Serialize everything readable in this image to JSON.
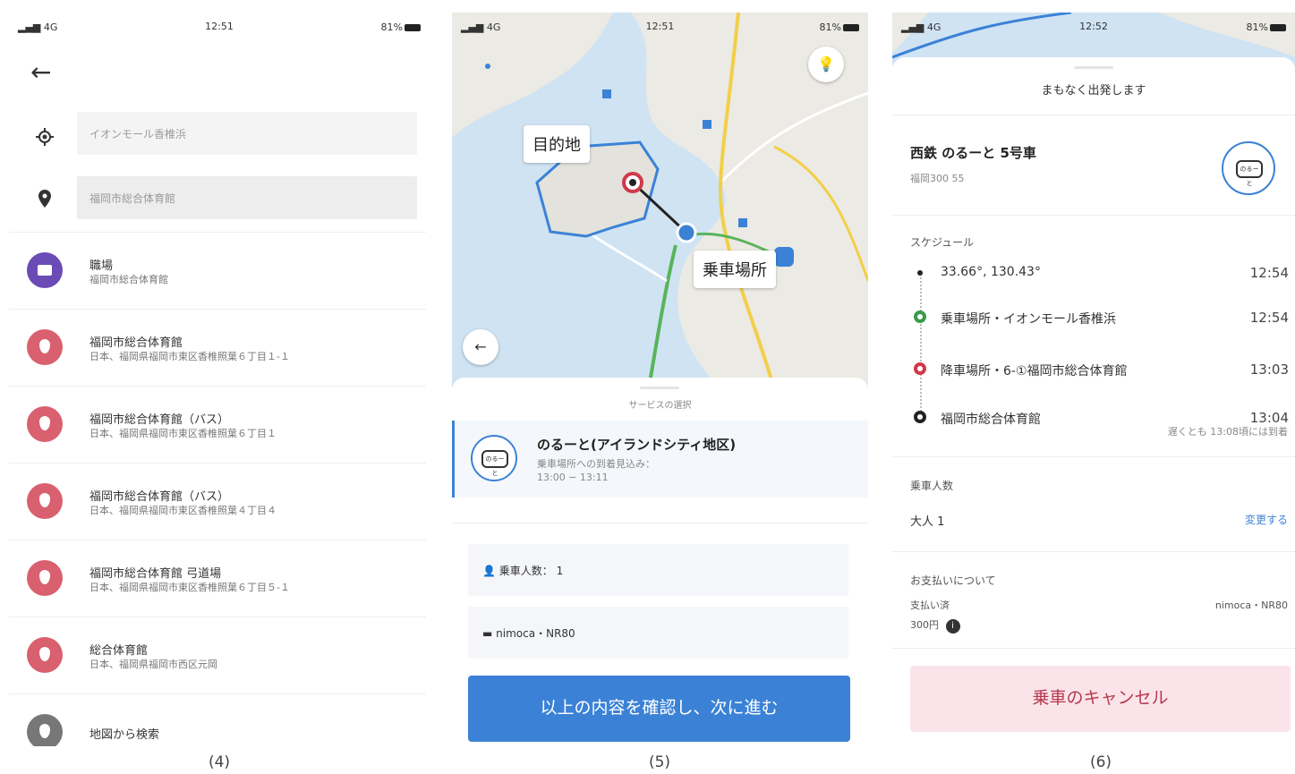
{
  "captions": {
    "p4": "(4)",
    "p5": "(5)",
    "p6": "(6)"
  },
  "panel4": {
    "status": {
      "signal": "4G",
      "time": "12:51",
      "battery": "81%"
    },
    "origin_value": "イオンモール香椎浜",
    "destination_value": "福岡市総合体育館",
    "results": [
      {
        "icon": "briefcase-icon",
        "color": "#6b4bb5",
        "title": "職場",
        "subtitle": "福岡市総合体育館"
      },
      {
        "icon": "location-pin-icon",
        "color": "#d9606e",
        "title": "福岡市総合体育館",
        "subtitle": "日本、福岡県福岡市東区香椎照葉６丁目１-１"
      },
      {
        "icon": "location-pin-icon",
        "color": "#d9606e",
        "title": "福岡市総合体育館（バス）",
        "subtitle": "日本、福岡県福岡市東区香椎照葉６丁目１"
      },
      {
        "icon": "location-pin-icon",
        "color": "#d9606e",
        "title": "福岡市総合体育館（バス）",
        "subtitle": "日本、福岡県福岡市東区香椎照葉４丁目４"
      },
      {
        "icon": "location-pin-icon",
        "color": "#d9606e",
        "title": "福岡市総合体育館 弓道場",
        "subtitle": "日本、福岡県福岡市東区香椎照葉６丁目５-１"
      },
      {
        "icon": "location-pin-icon",
        "color": "#d9606e",
        "title": "総合体育館",
        "subtitle": "日本、福岡県福岡市西区元岡"
      },
      {
        "icon": "location-pin-icon",
        "color": "#777777",
        "title": "地図から検索",
        "subtitle": ""
      }
    ]
  },
  "panel5": {
    "status": {
      "signal": "4G",
      "time": "12:51",
      "battery": "81%"
    },
    "map": {
      "destination_label": "目的地",
      "pickup_label": "乗車場所"
    },
    "sheet": {
      "header": "サービスの選択",
      "service_name": "のるーと(アイランドシティ地区)",
      "service_note": "乗車場所への到着見込み：",
      "service_time": "13:00 − 13:11",
      "bus_icon_text": "のるーと",
      "passengers": "乗車人数： 1",
      "payment": "nimoca・NR80",
      "confirm_button": "以上の内容を確認し、次に進む"
    }
  },
  "panel6": {
    "status": {
      "signal": "4G",
      "time": "12:52",
      "battery": "81%"
    },
    "sheet_title": "まもなく出発します",
    "vehicle_name": "西鉄 のるーと 5号車",
    "vehicle_plate": "福岡300 55",
    "schedule_label": "スケジュール",
    "schedule": [
      {
        "name": "33.66°, 130.43°",
        "time": "12:54",
        "color": "#222222",
        "kind": "small"
      },
      {
        "name": "乗車場所・イオンモール香椎浜",
        "time": "12:54",
        "color": "#3a9a4a",
        "kind": "ring"
      },
      {
        "name": "降車場所・6-①福岡市総合体育館",
        "time": "13:03",
        "color": "#d0394a",
        "kind": "ring"
      },
      {
        "name": "福岡市総合体育館",
        "time": "13:04",
        "color": "#222222",
        "kind": "ring"
      }
    ],
    "schedule_note": "遅くとも 13:08頃には到着",
    "passengers_label": "乗車人数",
    "passengers_value": "大人 1",
    "change_link": "変更する",
    "payment_label": "お支払いについて",
    "payment_status": "支払い済",
    "payment_amount": "300円",
    "payment_method": "nimoca・NR80",
    "cancel_button": "乗車のキャンセル",
    "accent": "#3b82d6"
  }
}
